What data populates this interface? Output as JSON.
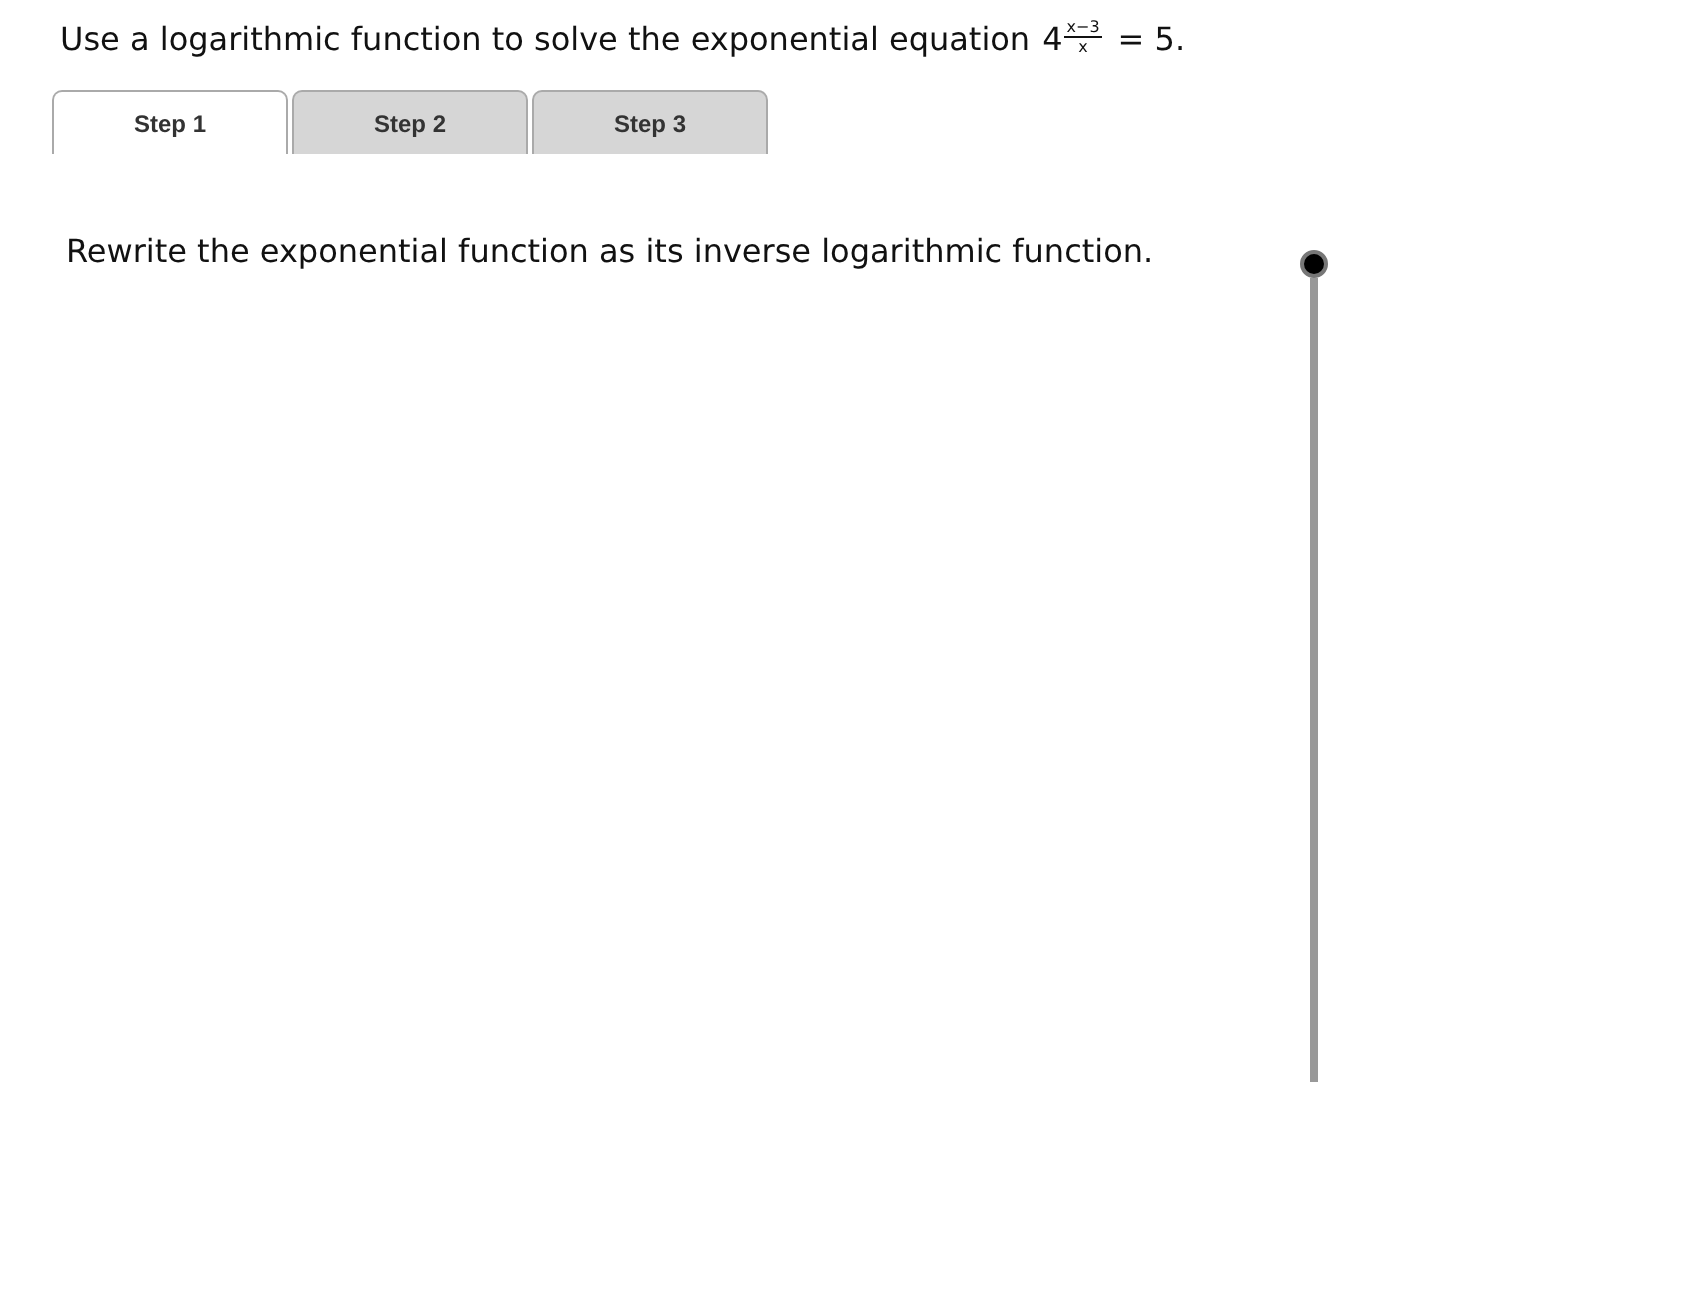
{
  "question": {
    "text": "Use a logarithmic function to solve the exponential equation",
    "base": "4",
    "exponent_numerator": "x−3",
    "exponent_denominator": "x",
    "rest": "= 5."
  },
  "tabs": [
    {
      "label": "Step 1",
      "selected": true
    },
    {
      "label": "Step 2",
      "selected": false
    },
    {
      "label": "Step 3",
      "selected": false
    }
  ],
  "instruction": "Rewrite the exponential function as its inverse logarithmic function.",
  "slider": {
    "level": 1
  }
}
